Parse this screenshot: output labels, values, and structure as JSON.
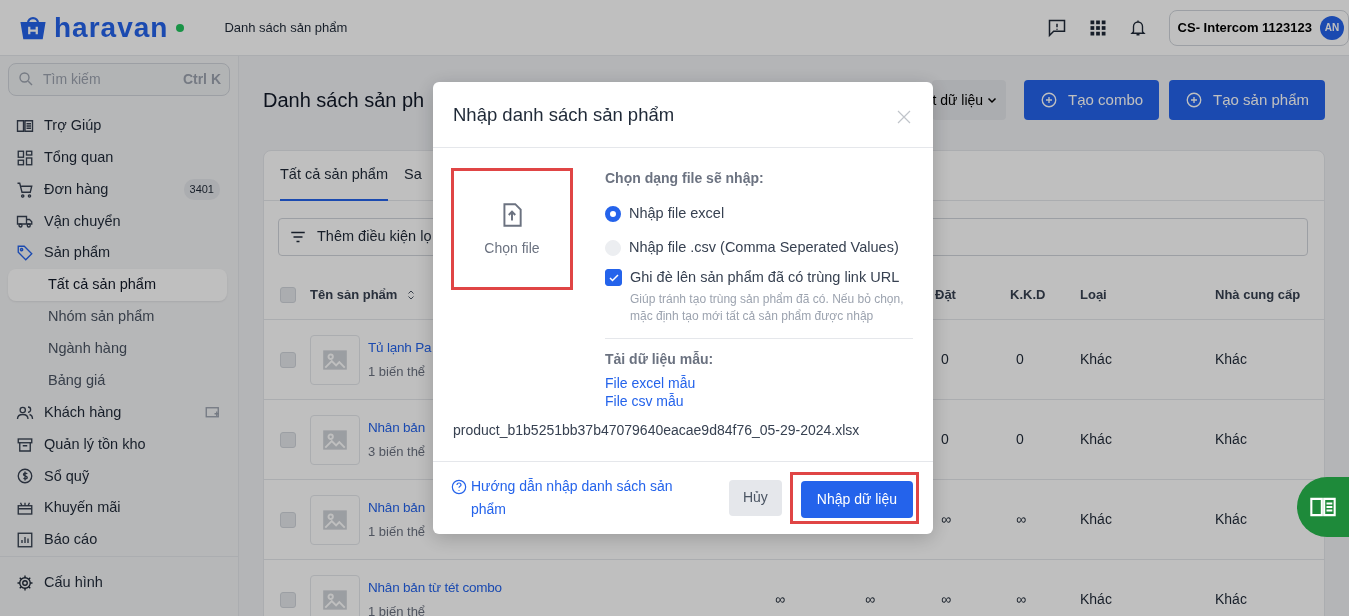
{
  "topbar": {
    "brand": "haravan",
    "online": true,
    "breadcrumb": "Danh sách sản phẩm",
    "account": "CS- Intercom 1123123",
    "avatar": "AN"
  },
  "sidebar": {
    "search_placeholder": "Tìm kiếm",
    "shortcut": "Ctrl K",
    "items": [
      {
        "label": "Trợ Giúp",
        "selected": false
      },
      {
        "label": "Tổng quan",
        "selected": false
      },
      {
        "label": "Đơn hàng",
        "selected": false,
        "badge": "3401"
      },
      {
        "label": "Vận chuyển",
        "selected": false
      },
      {
        "label": "Sản phẩm",
        "selected": true,
        "children": [
          {
            "label": "Tất cả sản phẩm",
            "selected": true
          },
          {
            "label": "Nhóm sản phẩm",
            "selected": false
          },
          {
            "label": "Ngành hàng",
            "selected": false
          },
          {
            "label": "Bảng giá",
            "selected": false
          }
        ]
      },
      {
        "label": "Khách hàng",
        "selected": false
      },
      {
        "label": "Quản lý tồn kho",
        "selected": false
      },
      {
        "label": "Sổ quỹ",
        "selected": false
      },
      {
        "label": "Khuyến mãi",
        "selected": false
      },
      {
        "label": "Báo cáo",
        "selected": false
      }
    ],
    "footer": "Cấu hình"
  },
  "page": {
    "title": "Danh sách sản ph",
    "export_menu": "t dữ liệu",
    "buttons": [
      "Tạo combo",
      "Tạo sản phẩm"
    ]
  },
  "tabs": [
    {
      "label": "Tất cả sản phẩm",
      "selected": true
    },
    {
      "label": "Sa",
      "selected": false
    }
  ],
  "filter_button": "Thêm điều kiện lọ",
  "table": {
    "header_selected": false,
    "name_column": "Tên sản phẩm",
    "right_columns": [
      "Đặt",
      "K.K.D",
      "Loại",
      "Nhà cung cấp"
    ],
    "rows": [
      {
        "selected": false,
        "name": "Tủ lạnh Pa",
        "variants": "1 biến thể",
        "cells": [
          "0",
          "0",
          "Khác",
          "Khác"
        ]
      },
      {
        "selected": false,
        "name": "Nhân bản",
        "variants": "3 biến thể",
        "cells": [
          "0",
          "0",
          "Khác",
          "Khác"
        ]
      },
      {
        "selected": false,
        "name": "Nhân bản",
        "variants": "1 biến thể",
        "cells": [
          "∞",
          "∞",
          "Khác",
          "Khác"
        ]
      },
      {
        "selected": false,
        "name": "Nhân bản từ tét combo",
        "variants": "1 biến thể",
        "middle_cells": [
          "∞",
          "∞"
        ],
        "cells": [
          "∞",
          "∞",
          "Khác",
          "Khác"
        ]
      }
    ]
  },
  "modal": {
    "title": "Nhập danh sách sản phẩm",
    "upload": {
      "label": "Chọn file",
      "highlighted": true
    },
    "file_type_label": "Chọn dạng file sẽ nhập:",
    "file_types": [
      {
        "label": "Nhập file excel",
        "selected": true,
        "disabled": false
      },
      {
        "label": "Nhập file .csv (Comma Seperated Values)",
        "selected": false,
        "disabled": true
      }
    ],
    "overwrite": {
      "label": "Ghi đè lên sản phẩm đã có trùng link URL",
      "checked": true,
      "help": "Giúp tránh tạo trùng sản phẩm đã có. Nếu bỏ chọn, mặc định tạo mới tất cả sản phẩm được nhập"
    },
    "samples_label": "Tải dữ liệu mẫu:",
    "samples": [
      "File excel mẫu",
      "File csv mẫu"
    ],
    "file_name": "product_b1b5251bb37b47079640eacae9d84f76_05-29-2024.xlsx",
    "help_link": "Hướng dẫn nhập danh sách sản phẩm",
    "cancel": "Hủy",
    "submit": {
      "label": "Nhập dữ liệu",
      "highlighted": true
    }
  }
}
